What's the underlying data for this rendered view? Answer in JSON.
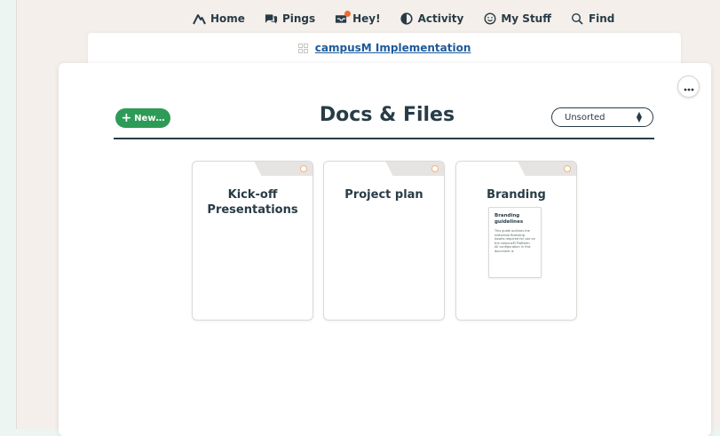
{
  "nav": {
    "items": [
      {
        "label": "Home",
        "icon": "basecamp-mountain-icon"
      },
      {
        "label": "Pings",
        "icon": "chat-bubbles-icon"
      },
      {
        "label": "Hey!",
        "icon": "hey-tray-icon"
      },
      {
        "label": "Activity",
        "icon": "half-circle-activity-icon"
      },
      {
        "label": "My Stuff",
        "icon": "smiley-face-icon"
      },
      {
        "label": "Find",
        "icon": "search-icon"
      }
    ],
    "notification_color": "#f26b2b"
  },
  "project": {
    "name": "campusM Implementation",
    "link_color": "#1e5a9a"
  },
  "docs": {
    "title": "Docs & Files",
    "new_label": "New…",
    "sort_value": "Unsorted",
    "accent_color": "#2d9b57",
    "folders": [
      {
        "name": "Kick-off Presentations"
      },
      {
        "name": "Project plan"
      },
      {
        "name": "Branding",
        "thumbnail": {
          "title": "Branding guidelines",
          "body": "This guide outlines the individual Branding Assets required for use on the campusM Platform. All configuration in this document is"
        }
      }
    ]
  }
}
